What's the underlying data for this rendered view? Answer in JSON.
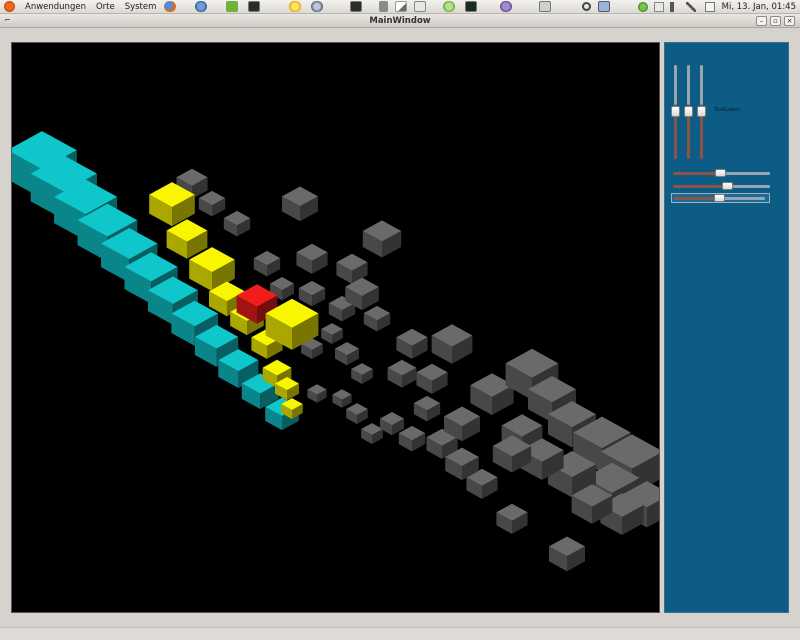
{
  "panel": {
    "menus": [
      "Anwendungen",
      "Orte",
      "System"
    ],
    "clock": "Mi, 13. Jan, 01:45",
    "launchers": [
      "firefox-icon",
      "thunderbird-icon",
      "qt-creator-icon",
      "terminal-icon",
      "bookmarks-icon",
      "settings-icon",
      "terminal2-icon",
      "calculator-icon",
      "text-editor-icon",
      "dictionary-icon",
      "pidgin-icon",
      "system-monitor-icon",
      "gimp-icon",
      "screenshot-icon",
      "search-icon",
      "show-desktop-icon"
    ],
    "tray": [
      "network-icon",
      "notes-icon",
      "volume-icon",
      "power-icon",
      "mail-icon"
    ]
  },
  "window": {
    "title": "MainWindow"
  },
  "controls": {
    "text_label": "TextLabel",
    "vertical_sliders": [
      0.5,
      0.5,
      0.5
    ],
    "horizontal_sliders": [
      0.5,
      0.57,
      0.5
    ]
  },
  "colors": {
    "scene_background": "#000000",
    "side_panel": "#0c5c86",
    "teal_cubes": "#0c9ea2",
    "yellow_cubes": "#c8c400",
    "red_cube": "#c11616",
    "grey_cubes": "#555555"
  }
}
